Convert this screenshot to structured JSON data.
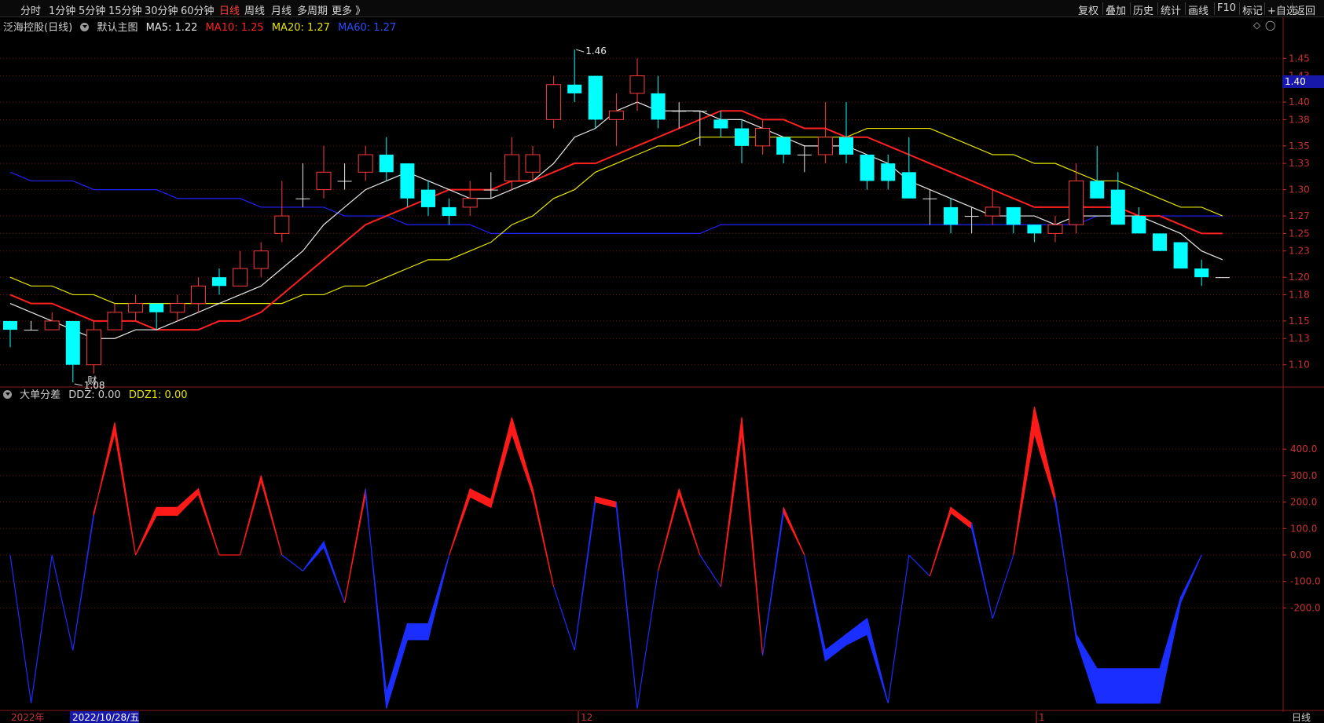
{
  "toolbar": {
    "periods": [
      "分时",
      "1分钟",
      "5分钟",
      "15分钟",
      "30分钟",
      "60分钟",
      "日线",
      "周线",
      "月线",
      "多周期",
      "更多 》"
    ],
    "active_period": "日线",
    "right_buttons": [
      "复权",
      "叠加",
      "历史",
      "统计",
      "画线",
      "F10",
      "标记",
      "+自选",
      "返回"
    ]
  },
  "main_legend": {
    "stock_name": "泛海控股(日线)",
    "template": "默认主图",
    "ma5": "MA5: 1.22",
    "ma10": "MA10: 1.25",
    "ma20": "MA20: 1.27",
    "ma60": "MA60: 1.27"
  },
  "indicator_legend": {
    "name": "大单分差",
    "ddz": "DDZ: 0.00",
    "ddz1": "DDZ1: 0.00"
  },
  "current_price_tag": "1.40",
  "bottom_bar": {
    "year_label": "2022年",
    "selected_date": "2022/10/28/五",
    "month_labels": [
      "12",
      "1"
    ],
    "period_label": "日线"
  },
  "annotations": {
    "high_label": "1.46",
    "low_label": "1.08",
    "event_marker": "财"
  },
  "colors": {
    "up": "#ff3b3b",
    "down": "#00ffff",
    "ma5": "#e8e8e8",
    "ma10": "#ff2020",
    "ma20": "#e6e600",
    "ma60": "#2020ff",
    "ddz_up": "#ff1a1a",
    "ddz_down": "#1a2eff",
    "grid": "#7a1414",
    "axis_text": "#c83232"
  },
  "chart_data": [
    {
      "type": "candlestick",
      "title": "泛海控股(日线)",
      "y_ticks": [
        "1.45",
        "1.43",
        "1.40",
        "1.38",
        "1.35",
        "1.33",
        "1.30",
        "1.27",
        "1.25",
        "1.23",
        "1.20",
        "1.18",
        "1.15",
        "1.13",
        "1.10"
      ],
      "ylim": [
        1.08,
        1.47
      ],
      "candles": [
        {
          "o": 1.15,
          "c": 1.14,
          "h": 1.15,
          "l": 1.12
        },
        {
          "o": 1.14,
          "c": 1.14,
          "h": 1.15,
          "l": 1.14
        },
        {
          "o": 1.14,
          "c": 1.15,
          "h": 1.16,
          "l": 1.14
        },
        {
          "o": 1.15,
          "c": 1.1,
          "h": 1.15,
          "l": 1.08
        },
        {
          "o": 1.1,
          "c": 1.14,
          "h": 1.15,
          "l": 1.09
        },
        {
          "o": 1.14,
          "c": 1.16,
          "h": 1.17,
          "l": 1.14
        },
        {
          "o": 1.16,
          "c": 1.17,
          "h": 1.18,
          "l": 1.15
        },
        {
          "o": 1.17,
          "c": 1.16,
          "h": 1.17,
          "l": 1.14
        },
        {
          "o": 1.16,
          "c": 1.17,
          "h": 1.18,
          "l": 1.15
        },
        {
          "o": 1.17,
          "c": 1.19,
          "h": 1.2,
          "l": 1.16
        },
        {
          "o": 1.2,
          "c": 1.19,
          "h": 1.21,
          "l": 1.18
        },
        {
          "o": 1.19,
          "c": 1.21,
          "h": 1.23,
          "l": 1.19
        },
        {
          "o": 1.21,
          "c": 1.23,
          "h": 1.24,
          "l": 1.2
        },
        {
          "o": 1.25,
          "c": 1.27,
          "h": 1.31,
          "l": 1.24
        },
        {
          "o": 1.29,
          "c": 1.29,
          "h": 1.33,
          "l": 1.28
        },
        {
          "o": 1.3,
          "c": 1.32,
          "h": 1.35,
          "l": 1.29
        },
        {
          "o": 1.31,
          "c": 1.31,
          "h": 1.33,
          "l": 1.3
        },
        {
          "o": 1.32,
          "c": 1.34,
          "h": 1.35,
          "l": 1.31
        },
        {
          "o": 1.34,
          "c": 1.32,
          "h": 1.36,
          "l": 1.31
        },
        {
          "o": 1.33,
          "c": 1.29,
          "h": 1.33,
          "l": 1.28
        },
        {
          "o": 1.3,
          "c": 1.28,
          "h": 1.31,
          "l": 1.27
        },
        {
          "o": 1.28,
          "c": 1.27,
          "h": 1.29,
          "l": 1.26
        },
        {
          "o": 1.28,
          "c": 1.29,
          "h": 1.31,
          "l": 1.27
        },
        {
          "o": 1.3,
          "c": 1.3,
          "h": 1.32,
          "l": 1.29
        },
        {
          "o": 1.31,
          "c": 1.34,
          "h": 1.36,
          "l": 1.3
        },
        {
          "o": 1.32,
          "c": 1.34,
          "h": 1.35,
          "l": 1.31
        },
        {
          "o": 1.38,
          "c": 1.42,
          "h": 1.43,
          "l": 1.37
        },
        {
          "o": 1.42,
          "c": 1.41,
          "h": 1.46,
          "l": 1.4
        },
        {
          "o": 1.43,
          "c": 1.38,
          "h": 1.43,
          "l": 1.37
        },
        {
          "o": 1.38,
          "c": 1.39,
          "h": 1.41,
          "l": 1.35
        },
        {
          "o": 1.41,
          "c": 1.43,
          "h": 1.45,
          "l": 1.39
        },
        {
          "o": 1.41,
          "c": 1.38,
          "h": 1.43,
          "l": 1.37
        },
        {
          "o": 1.39,
          "c": 1.39,
          "h": 1.4,
          "l": 1.37
        },
        {
          "o": 1.39,
          "c": 1.39,
          "h": 1.39,
          "l": 1.35
        },
        {
          "o": 1.38,
          "c": 1.37,
          "h": 1.39,
          "l": 1.36
        },
        {
          "o": 1.37,
          "c": 1.35,
          "h": 1.38,
          "l": 1.33
        },
        {
          "o": 1.35,
          "c": 1.37,
          "h": 1.38,
          "l": 1.34
        },
        {
          "o": 1.36,
          "c": 1.34,
          "h": 1.36,
          "l": 1.33
        },
        {
          "o": 1.34,
          "c": 1.34,
          "h": 1.35,
          "l": 1.32
        },
        {
          "o": 1.34,
          "c": 1.36,
          "h": 1.4,
          "l": 1.33
        },
        {
          "o": 1.36,
          "c": 1.34,
          "h": 1.4,
          "l": 1.33
        },
        {
          "o": 1.34,
          "c": 1.31,
          "h": 1.34,
          "l": 1.3
        },
        {
          "o": 1.33,
          "c": 1.31,
          "h": 1.34,
          "l": 1.3
        },
        {
          "o": 1.32,
          "c": 1.29,
          "h": 1.36,
          "l": 1.29
        },
        {
          "o": 1.29,
          "c": 1.29,
          "h": 1.3,
          "l": 1.26
        },
        {
          "o": 1.28,
          "c": 1.26,
          "h": 1.29,
          "l": 1.25
        },
        {
          "o": 1.27,
          "c": 1.27,
          "h": 1.28,
          "l": 1.25
        },
        {
          "o": 1.27,
          "c": 1.28,
          "h": 1.3,
          "l": 1.26
        },
        {
          "o": 1.28,
          "c": 1.26,
          "h": 1.28,
          "l": 1.25
        },
        {
          "o": 1.26,
          "c": 1.25,
          "h": 1.26,
          "l": 1.24
        },
        {
          "o": 1.25,
          "c": 1.26,
          "h": 1.27,
          "l": 1.24
        },
        {
          "o": 1.26,
          "c": 1.31,
          "h": 1.33,
          "l": 1.25
        },
        {
          "o": 1.31,
          "c": 1.29,
          "h": 1.35,
          "l": 1.29
        },
        {
          "o": 1.3,
          "c": 1.26,
          "h": 1.32,
          "l": 1.26
        },
        {
          "o": 1.27,
          "c": 1.25,
          "h": 1.28,
          "l": 1.25
        },
        {
          "o": 1.25,
          "c": 1.23,
          "h": 1.25,
          "l": 1.23
        },
        {
          "o": 1.24,
          "c": 1.21,
          "h": 1.24,
          "l": 1.21
        },
        {
          "o": 1.21,
          "c": 1.2,
          "h": 1.22,
          "l": 1.19
        },
        {
          "o": 1.2,
          "c": 1.2,
          "h": 1.2,
          "l": 1.2
        }
      ],
      "ma5": [
        1.17,
        1.16,
        1.15,
        1.14,
        1.13,
        1.13,
        1.14,
        1.14,
        1.15,
        1.16,
        1.17,
        1.18,
        1.19,
        1.21,
        1.23,
        1.26,
        1.28,
        1.3,
        1.31,
        1.32,
        1.31,
        1.3,
        1.29,
        1.29,
        1.3,
        1.31,
        1.33,
        1.36,
        1.37,
        1.39,
        1.4,
        1.39,
        1.39,
        1.39,
        1.38,
        1.38,
        1.37,
        1.36,
        1.35,
        1.35,
        1.35,
        1.34,
        1.33,
        1.31,
        1.3,
        1.29,
        1.28,
        1.27,
        1.27,
        1.27,
        1.26,
        1.27,
        1.27,
        1.27,
        1.27,
        1.26,
        1.25,
        1.23,
        1.22
      ],
      "ma10": [
        1.18,
        1.17,
        1.17,
        1.16,
        1.15,
        1.15,
        1.15,
        1.14,
        1.14,
        1.14,
        1.15,
        1.15,
        1.16,
        1.18,
        1.2,
        1.22,
        1.24,
        1.26,
        1.27,
        1.28,
        1.29,
        1.3,
        1.3,
        1.3,
        1.31,
        1.31,
        1.32,
        1.33,
        1.33,
        1.34,
        1.35,
        1.36,
        1.37,
        1.38,
        1.39,
        1.39,
        1.38,
        1.38,
        1.37,
        1.37,
        1.36,
        1.36,
        1.35,
        1.34,
        1.33,
        1.32,
        1.31,
        1.3,
        1.29,
        1.28,
        1.28,
        1.28,
        1.28,
        1.28,
        1.27,
        1.27,
        1.26,
        1.25,
        1.25
      ],
      "ma20": [
        1.2,
        1.19,
        1.19,
        1.18,
        1.18,
        1.17,
        1.17,
        1.17,
        1.17,
        1.17,
        1.17,
        1.17,
        1.17,
        1.17,
        1.18,
        1.18,
        1.19,
        1.19,
        1.2,
        1.21,
        1.22,
        1.22,
        1.23,
        1.24,
        1.26,
        1.27,
        1.29,
        1.3,
        1.32,
        1.33,
        1.34,
        1.35,
        1.35,
        1.36,
        1.36,
        1.36,
        1.36,
        1.36,
        1.36,
        1.36,
        1.36,
        1.37,
        1.37,
        1.37,
        1.37,
        1.36,
        1.35,
        1.34,
        1.34,
        1.33,
        1.33,
        1.32,
        1.31,
        1.31,
        1.3,
        1.29,
        1.28,
        1.28,
        1.27
      ],
      "ma60": [
        1.32,
        1.31,
        1.31,
        1.31,
        1.3,
        1.3,
        1.3,
        1.3,
        1.29,
        1.29,
        1.29,
        1.29,
        1.28,
        1.28,
        1.28,
        1.28,
        1.27,
        1.27,
        1.27,
        1.26,
        1.26,
        1.26,
        1.26,
        1.25,
        1.25,
        1.25,
        1.25,
        1.25,
        1.25,
        1.25,
        1.25,
        1.25,
        1.25,
        1.25,
        1.26,
        1.26,
        1.26,
        1.26,
        1.26,
        1.26,
        1.26,
        1.26,
        1.26,
        1.26,
        1.26,
        1.26,
        1.26,
        1.26,
        1.26,
        1.26,
        1.26,
        1.26,
        1.27,
        1.27,
        1.27,
        1.27,
        1.27,
        1.27,
        1.27
      ]
    },
    {
      "type": "area",
      "title": "大单分差",
      "y_ticks": [
        "400.0",
        "300.0",
        "200.0",
        "100.0",
        "0.00",
        "-100.0",
        "-200.0"
      ],
      "ylim": [
        -560,
        560
      ],
      "ddz": [
        0,
        -560,
        0,
        -360,
        150,
        500,
        0,
        180,
        180,
        250,
        0,
        0,
        300,
        0,
        -60,
        50,
        -180,
        250,
        -580,
        -320,
        -320,
        0,
        250,
        210,
        520,
        250,
        -120,
        -360,
        220,
        200,
        -580,
        -60,
        250,
        0,
        -120,
        520,
        -380,
        180,
        0,
        -400,
        -340,
        -300,
        -560,
        0,
        -80,
        180,
        120,
        -240,
        0,
        560,
        220,
        -320,
        -560,
        -560,
        -560,
        -560,
        -180,
        0
      ],
      "ddz1": [
        0,
        -560,
        0,
        -360,
        160,
        460,
        0,
        150,
        150,
        230,
        0,
        0,
        280,
        0,
        -60,
        30,
        -180,
        230,
        -520,
        -260,
        -260,
        0,
        220,
        180,
        460,
        230,
        -120,
        -360,
        200,
        180,
        -580,
        -60,
        230,
        0,
        -120,
        460,
        -380,
        160,
        0,
        -360,
        -300,
        -240,
        -560,
        0,
        -80,
        160,
        100,
        -240,
        0,
        460,
        200,
        -300,
        -430,
        -430,
        -430,
        -430,
        -160,
        0
      ]
    }
  ]
}
